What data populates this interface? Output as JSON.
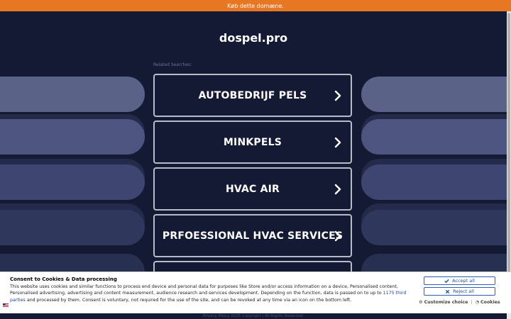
{
  "topbar": {
    "buy_text": "Køb dette domæne."
  },
  "header": {
    "domain": "dospel.pro"
  },
  "related": {
    "label": "Related Searches:"
  },
  "searches": [
    {
      "label": "AUTOBEDRIJF PELS"
    },
    {
      "label": "MINKPELS"
    },
    {
      "label": "HVAC AIR"
    },
    {
      "label": "PRFOESSIONAL HVAC SERVICES"
    },
    {
      "label": ""
    }
  ],
  "consent": {
    "title": "Consent to Cookies & Data processing",
    "text_before": "This website uses cookies and similar functions to process end device and personal data for purposes like Store and/or access information on a device, Personalised content, Personalised advertising, advertising and content measurement, audience research and services development. Depending on the function, data is passed on to up to ",
    "third_parties_link": "1175 third parties",
    "text_after": " and processed by them. Consent is voluntary, not required for the use of the site, and can be revoked at any time via an icon on the bottom left.",
    "accept_label": "Accept all",
    "reject_label": "Reject all",
    "customize_label": "Customize choice",
    "separator": "|",
    "cookies_label": "Cookies"
  },
  "footer": {
    "privacy_label": "Privacy Policy",
    "copyright": "2025 Copyright | All Rights Reserved."
  },
  "colors": {
    "background": "#141a33",
    "topbar": "#e87724",
    "accent_blue": "#1f4f9e"
  }
}
